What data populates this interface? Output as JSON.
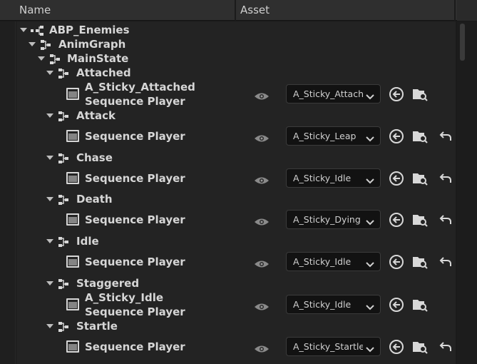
{
  "header": {
    "name_col": "Name",
    "asset_col": "Asset"
  },
  "tree": {
    "root": "ABP_Enemies",
    "anim_graph": "AnimGraph",
    "main_state": "MainState",
    "states": [
      {
        "name": "Attached",
        "player_lines": [
          "A_Sticky_Attached",
          "Sequence Player"
        ],
        "asset": "A_Sticky_Attached",
        "reset": false
      },
      {
        "name": "Attack",
        "player_lines": [
          "Sequence Player"
        ],
        "asset": "A_Sticky_Leap",
        "reset": true
      },
      {
        "name": "Chase",
        "player_lines": [
          "Sequence Player"
        ],
        "asset": "A_Sticky_Idle",
        "reset": true
      },
      {
        "name": "Death",
        "player_lines": [
          "Sequence Player"
        ],
        "asset": "A_Sticky_Dying",
        "reset": true
      },
      {
        "name": "Idle",
        "player_lines": [
          "Sequence Player"
        ],
        "asset": "A_Sticky_Idle",
        "reset": true
      },
      {
        "name": "Staggered",
        "player_lines": [
          "A_Sticky_Idle",
          "Sequence Player"
        ],
        "asset": "A_Sticky_Idle",
        "reset": false
      },
      {
        "name": "Startle",
        "player_lines": [
          "Sequence Player"
        ],
        "asset": "A_Sticky_Startle",
        "reset": true
      }
    ]
  },
  "icons": {
    "expand": "chevron-down-icon",
    "graph": "state-graph-icon",
    "sequence": "sequence-player-icon",
    "visibility": "eye-icon",
    "use_selected": "use-selected-asset-icon",
    "browse": "browse-to-asset-icon",
    "reset": "reset-to-default-icon"
  },
  "colors": {
    "background": "#1a1a1a",
    "panel": "#232323",
    "header": "#2f2f2f",
    "text": "#d6d6d6"
  }
}
